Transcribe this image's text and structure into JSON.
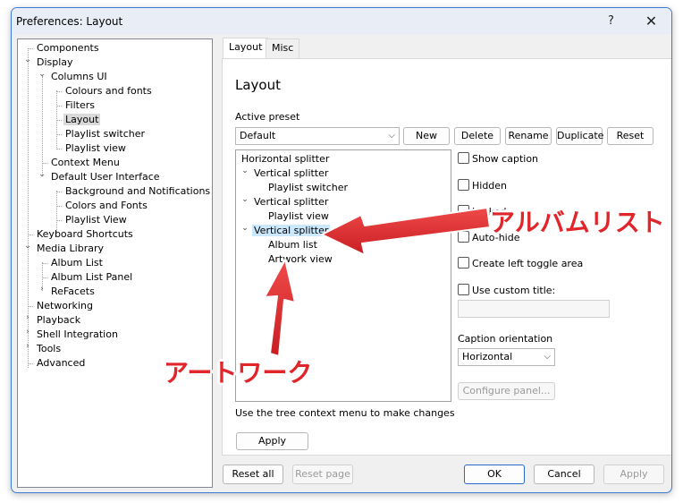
{
  "window": {
    "title": "Preferences: Layout",
    "help_glyph": "?",
    "close_glyph": "✕"
  },
  "tree": {
    "items": [
      {
        "label": "Components"
      },
      {
        "label": "Display"
      },
      {
        "label": "Columns UI"
      },
      {
        "label": "Colours and fonts"
      },
      {
        "label": "Filters"
      },
      {
        "label": "Layout"
      },
      {
        "label": "Playlist switcher"
      },
      {
        "label": "Playlist view"
      },
      {
        "label": "Context Menu"
      },
      {
        "label": "Default User Interface"
      },
      {
        "label": "Background and Notifications"
      },
      {
        "label": "Colors and Fonts"
      },
      {
        "label": "Playlist View"
      },
      {
        "label": "Keyboard Shortcuts"
      },
      {
        "label": "Media Library"
      },
      {
        "label": "Album List"
      },
      {
        "label": "Album List Panel"
      },
      {
        "label": "ReFacets"
      },
      {
        "label": "Networking"
      },
      {
        "label": "Playback"
      },
      {
        "label": "Shell Integration"
      },
      {
        "label": "Tools"
      },
      {
        "label": "Advanced"
      }
    ]
  },
  "tabs": [
    {
      "label": "Layout"
    },
    {
      "label": "Misc"
    }
  ],
  "panel": {
    "title": "Layout",
    "active_preset_label": "Active preset",
    "preset_value": "Default",
    "preset_buttons": {
      "new": "New",
      "delete": "Delete",
      "rename": "Rename",
      "duplicate": "Duplicate",
      "reset": "Reset"
    },
    "layout_tree": [
      {
        "label": "Horizontal splitter"
      },
      {
        "label": "Vertical splitter"
      },
      {
        "label": "Playlist switcher"
      },
      {
        "label": "Vertical splitter"
      },
      {
        "label": "Playlist view"
      },
      {
        "label": "Vertical splitter"
      },
      {
        "label": "Album list"
      },
      {
        "label": "Artwork view"
      }
    ],
    "options": {
      "show_caption": "Show caption",
      "hidden": "Hidden",
      "locked": "Locked",
      "autohide": "Auto-hide",
      "left_toggle": "Create left toggle area",
      "custom_title": "Use custom title:"
    },
    "caption_orientation_label": "Caption orientation",
    "caption_orientation_value": "Horizontal",
    "configure_panel": "Configure panel...",
    "hint": "Use the tree context menu to make changes",
    "apply": "Apply"
  },
  "footer": {
    "reset_all": "Reset all",
    "reset_page": "Reset page",
    "ok": "OK",
    "cancel": "Cancel",
    "apply": "Apply"
  },
  "annotations": {
    "album_list": "アルバムリスト",
    "artwork": "アートワーク",
    "color": "#e0262a"
  }
}
